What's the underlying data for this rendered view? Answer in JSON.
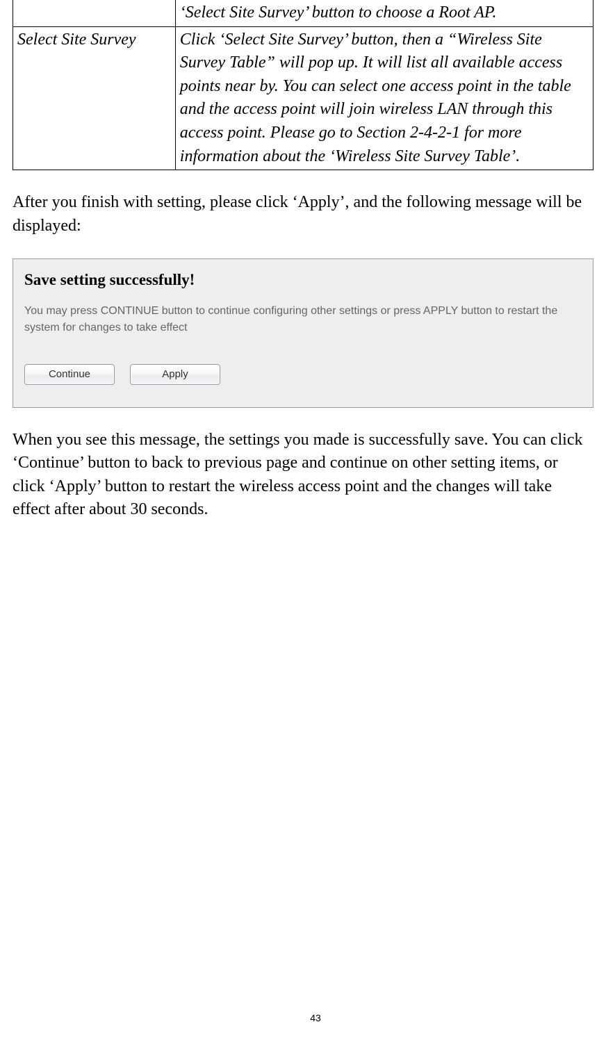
{
  "table": {
    "row0_right": "‘Select Site Survey’ button to choose a Root AP.",
    "row1_left": "Select Site Survey",
    "row1_right": "Click ‘Select Site Survey’ button, then a “Wireless Site Survey Table” will pop up. It will list all available access points near by. You can select one access point in the table and the access point will join wireless LAN through this access point. Please go to Section 2-4-2-1 for more information about the ‘Wireless Site Survey Table’."
  },
  "para1": "After you finish with setting, please click ‘Apply’, and the following message will be displayed:",
  "dialog": {
    "title": "Save setting successfully!",
    "message": "You may press CONTINUE button to continue configuring other settings or press APPLY button to restart the system for changes to take effect",
    "continue_label": "Continue",
    "apply_label": "Apply"
  },
  "para2": "When you see this message, the settings you made is successfully save. You can click ‘Continue’ button to back to previous page and continue on other setting items, or click ‘Apply’ button to restart the wireless access point and the changes will take effect after about 30 seconds.",
  "page_number": "43"
}
